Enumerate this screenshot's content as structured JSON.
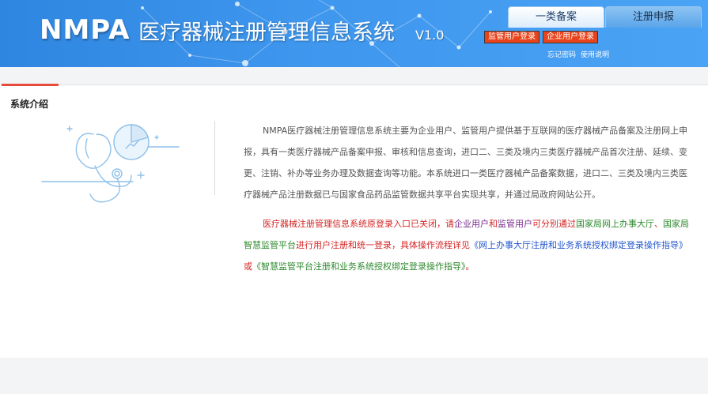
{
  "header": {
    "logo": "NMPA",
    "title": "医疗器械注册管理信息系统",
    "version": "V1.0",
    "tabs": [
      {
        "label": "一类备案",
        "active": true
      },
      {
        "label": "注册申报",
        "active": false
      }
    ],
    "buttons": {
      "regulator_login": "监管用户登录",
      "enterprise_login": "企业用户登录"
    },
    "links": {
      "forgot_password": "忘记密码",
      "user_manual": "使用说明"
    }
  },
  "section": {
    "title": "系统介绍",
    "paragraph1": "NMPA医疗器械注册管理信息系统主要为企业用户、监管用户提供基于互联网的医疗器械产品备案及注册网上申报，具有一类医疗器械产品备案申报、审核和信息查询，进口二、三类及境内三类医疗器械产品首次注册、延续、变更、注销、补办等业务办理及数据查询等功能。本系统进口一类医疗器械产品备案数据，进口二、三类及境内三类医疗器械产品注册数据已与国家食品药品监管数据共享平台实现共享，并通过局政府网站公开。",
    "notice": {
      "part1": "医疗器械注册管理信息系统原登录入口已关闭，请",
      "part2": "企业用户",
      "part3": "和",
      "part4": "监管用户",
      "part5": "可分别通过",
      "part6": "国家局网上办事大厅",
      "part7": "、",
      "part8": "国家局智慧监管平台",
      "part9": "进行用户注册和统一登录，具体操作流程详见",
      "part10": "《网上办事大厅注册和业务系统授权绑定登录操作指导》",
      "part11": "或",
      "part12": "《智慧监管平台注册和业务系统授权绑定登录操作指导》",
      "part13": "。"
    }
  },
  "colors": {
    "header_blue": "#3f97ee",
    "login_button": "#e8431a",
    "accent_red": "#e74c3c",
    "notice_red": "#d42525",
    "notice_purple": "#7a2d8f",
    "notice_green": "#2f8a2f",
    "notice_blue": "#2255cc"
  },
  "icons": {
    "illustration": "stethoscope-chart-illustration-icon"
  }
}
